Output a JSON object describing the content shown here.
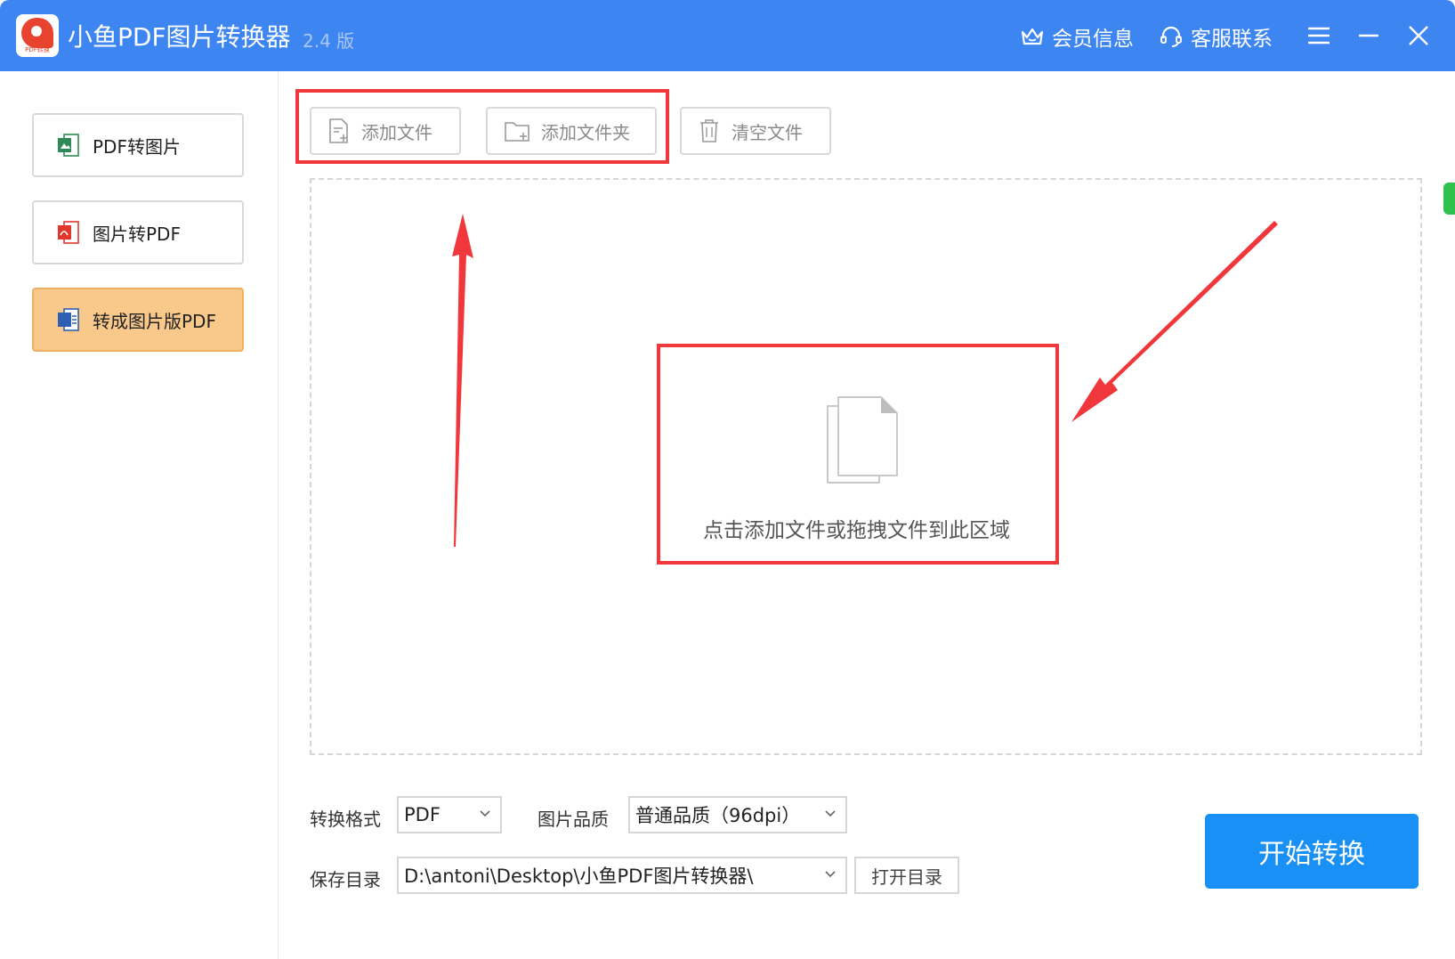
{
  "titlebar": {
    "app_title": "小鱼PDF图片转换器",
    "version": "2.4 版",
    "logo_text": "PDF转换",
    "member_label": "会员信息",
    "service_label": "客服联系"
  },
  "sidebar": {
    "items": [
      {
        "label": "PDF转图片",
        "icon": "jpg-file-icon",
        "color": "#2e8b57"
      },
      {
        "label": "图片转PDF",
        "icon": "pdf-file-icon",
        "color": "#e0362c"
      },
      {
        "label": "转成图片版PDF",
        "icon": "doc-file-icon",
        "color": "#2f5fb3",
        "active": true
      }
    ]
  },
  "toolbar": {
    "add_file": "添加文件",
    "add_folder": "添加文件夹",
    "clear_files": "清空文件"
  },
  "dropzone": {
    "hint": "点击添加文件或拖拽文件到此区域"
  },
  "options": {
    "format_label": "转换格式",
    "format_value": "PDF",
    "quality_label": "图片品质",
    "quality_value": "普通品质（96dpi）",
    "save_label": "保存目录",
    "save_path": "D:\\antoni\\Desktop\\小鱼PDF图片转换器\\",
    "open_dir": "打开目录",
    "start": "开始转换"
  },
  "colors": {
    "titlebar": "#3d86f2",
    "accent": "#1890f5",
    "active_item": "#f8c98a",
    "annotation": "#f0373b"
  }
}
